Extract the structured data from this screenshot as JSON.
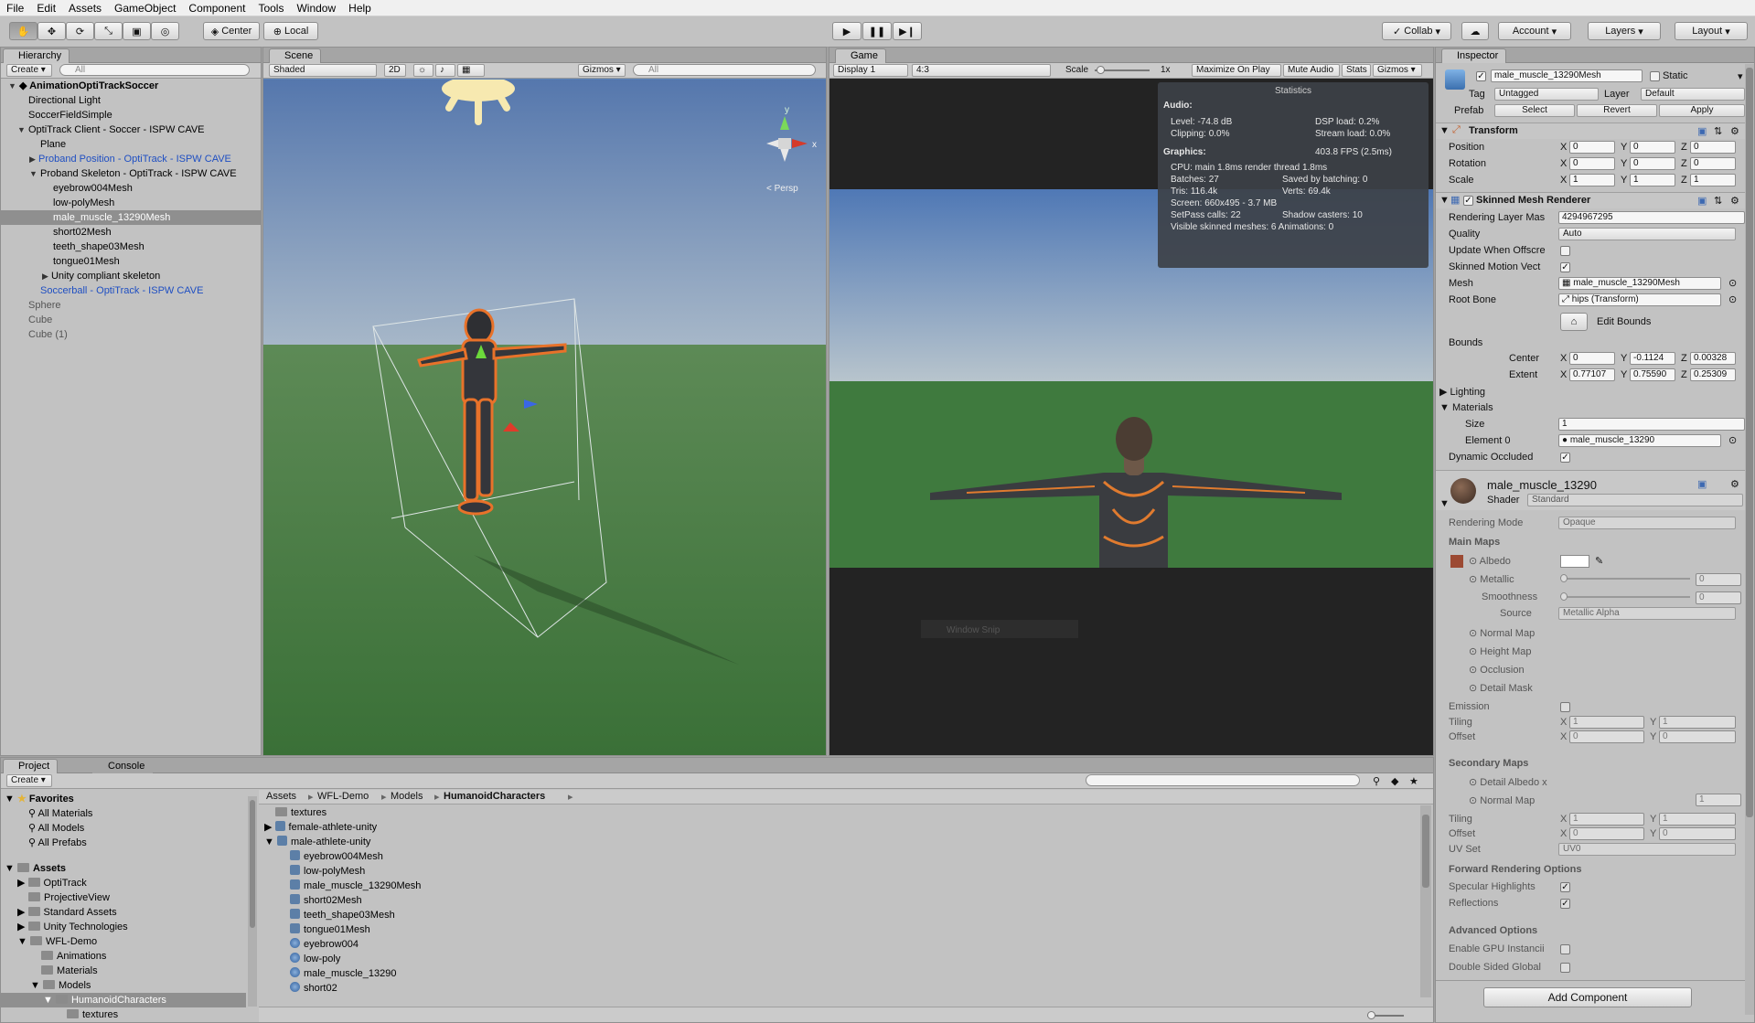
{
  "menu": [
    "File",
    "Edit",
    "Assets",
    "GameObject",
    "Component",
    "Tools",
    "Window",
    "Help"
  ],
  "toolbar": {
    "center": "Center",
    "local": "Local",
    "collab": "Collab",
    "account": "Account",
    "layers": "Layers",
    "layout": "Layout"
  },
  "hierarchy": {
    "tab": "Hierarchy",
    "create": "Create",
    "search_placeholder": "All",
    "scene": "AnimationOptiTrackSoccer",
    "rows": [
      "Directional Light",
      "SoccerFieldSimple",
      "OptiTrack Client - Soccer - ISPW CAVE",
      "Plane",
      "Proband Position - OptiTrack - ISPW CAVE",
      "Proband Skeleton - OptiTrack - ISPW CAVE",
      "eyebrow004Mesh",
      "low-polyMesh",
      "male_muscle_13290Mesh",
      "short02Mesh",
      "teeth_shape03Mesh",
      "tongue01Mesh",
      "Unity compliant skeleton",
      "Soccerball - OptiTrack - ISPW CAVE",
      "Sphere",
      "Cube",
      "Cube (1)"
    ]
  },
  "scene": {
    "tab": "Scene",
    "shading": "Shaded",
    "mode_2d": "2D",
    "gizmos": "Gizmos",
    "search_placeholder": "All",
    "persp": "Persp",
    "axis_y": "y",
    "axis_x": "x"
  },
  "game": {
    "tab": "Game",
    "display": "Display 1",
    "aspect": "4:3",
    "scale_label": "Scale",
    "scale_value": "1x",
    "maximize": "Maximize On Play",
    "mute": "Mute Audio",
    "stats": "Stats",
    "gizmos": "Gizmos",
    "window_snip": "Window Snip"
  },
  "statistics": {
    "title": "Statistics",
    "audio_header": "Audio:",
    "level": "Level: -74.8 dB",
    "clipping": "Clipping: 0.0%",
    "dsp": "DSP load: 0.2%",
    "stream": "Stream load: 0.0%",
    "graphics_header": "Graphics:",
    "fps": "403.8 FPS (2.5ms)",
    "cpu": "CPU: main 1.8ms  render thread 1.8ms",
    "batches": "Batches: 27",
    "saved": "Saved by batching: 0",
    "tris": "Tris: 116.4k",
    "verts": "Verts: 69.4k",
    "screen": "Screen: 660x495 - 3.7 MB",
    "setpass": "SetPass calls: 22",
    "shadow": "Shadow casters: 10",
    "visible": "Visible skinned meshes: 6  Animations: 0"
  },
  "inspector": {
    "tab": "Inspector",
    "object_name": "male_muscle_13290Mesh",
    "static": "Static",
    "tag_label": "Tag",
    "tag": "Untagged",
    "layer_label": "Layer",
    "layer": "Default",
    "prefab_label": "Prefab",
    "select": "Select",
    "revert": "Revert",
    "apply": "Apply",
    "transform": {
      "title": "Transform",
      "position": "Position",
      "rotation": "Rotation",
      "scale": "Scale",
      "pos": [
        "0",
        "0",
        "0"
      ],
      "rot": [
        "0",
        "0",
        "0"
      ],
      "scl": [
        "1",
        "1",
        "1"
      ]
    },
    "smr": {
      "title": "Skinned Mesh Renderer",
      "rendering_layer_label": "Rendering Layer Mas",
      "rendering_layer": "4294967295",
      "quality_label": "Quality",
      "quality": "Auto",
      "update_offscreen": "Update When Offscre",
      "skinned_motion": "Skinned Motion Vect",
      "mesh_label": "Mesh",
      "mesh": "male_muscle_13290Mesh",
      "root_bone_label": "Root Bone",
      "root_bone": "hips (Transform)",
      "edit_bounds": "Edit Bounds",
      "bounds": "Bounds",
      "center": "Center",
      "extent": "Extent",
      "center_vals": [
        "0",
        "-0.1124",
        "0.00328"
      ],
      "extent_vals": [
        "0.77107",
        "0.75590",
        "0.25309"
      ],
      "lighting": "Lighting",
      "materials": "Materials",
      "size_label": "Size",
      "size": "1",
      "element0_label": "Element 0",
      "element0": "male_muscle_13290",
      "dynamic_occluded": "Dynamic Occluded"
    },
    "material": {
      "name": "male_muscle_13290",
      "shader_label": "Shader",
      "shader": "Standard",
      "rendering_mode_label": "Rendering Mode",
      "rendering_mode": "Opaque",
      "main_maps": "Main Maps",
      "albedo": "Albedo",
      "metallic": "Metallic",
      "metallic_val": "0",
      "smoothness": "Smoothness",
      "smoothness_val": "0",
      "source": "Source",
      "source_val": "Metallic Alpha",
      "normal_map": "Normal Map",
      "height_map": "Height Map",
      "occlusion": "Occlusion",
      "detail_mask": "Detail Mask",
      "emission": "Emission",
      "tiling": "Tiling",
      "offset": "Offset",
      "tiling_vals": [
        "1",
        "1"
      ],
      "offset_vals": [
        "0",
        "0"
      ],
      "secondary_maps": "Secondary Maps",
      "detail_albedo": "Detail Albedo x",
      "normal_map2": "Normal Map",
      "normal_map2_val": "1",
      "tiling2_vals": [
        "1",
        "1"
      ],
      "offset2_vals": [
        "0",
        "0"
      ],
      "uv_set": "UV Set",
      "uv_set_val": "UV0",
      "forward": "Forward Rendering Options",
      "specular": "Specular Highlights",
      "reflections": "Reflections",
      "advanced": "Advanced Options",
      "gpu_instancing": "Enable GPU Instancii",
      "double_sided": "Double Sided Global"
    },
    "add_component": "Add Component"
  },
  "project": {
    "tab": "Project",
    "console_tab": "Console",
    "create": "Create",
    "favorites": "Favorites",
    "fav_items": [
      "All Materials",
      "All Models",
      "All Prefabs"
    ],
    "assets": "Assets",
    "tree": [
      "OptiTrack",
      "ProjectiveView",
      "Standard Assets",
      "Unity Technologies",
      "WFL-Demo",
      "Animations",
      "Materials",
      "Models",
      "HumanoidCharacters",
      "textures"
    ],
    "breadcrumb": [
      "Assets",
      "WFL-Demo",
      "Models",
      "HumanoidCharacters"
    ],
    "files": [
      "textures",
      "female-athlete-unity",
      "male-athlete-unity",
      "eyebrow004Mesh",
      "low-polyMesh",
      "male_muscle_13290Mesh",
      "short02Mesh",
      "teeth_shape03Mesh",
      "tongue01Mesh",
      "eyebrow004",
      "low-poly",
      "male_muscle_13290",
      "short02"
    ]
  },
  "colors": {
    "selection": "#8f8f8f",
    "link": "#1f4fc2",
    "sky": "#5e84b8",
    "ground": "#3f7a3e",
    "stats_bg": "#3d4148"
  }
}
